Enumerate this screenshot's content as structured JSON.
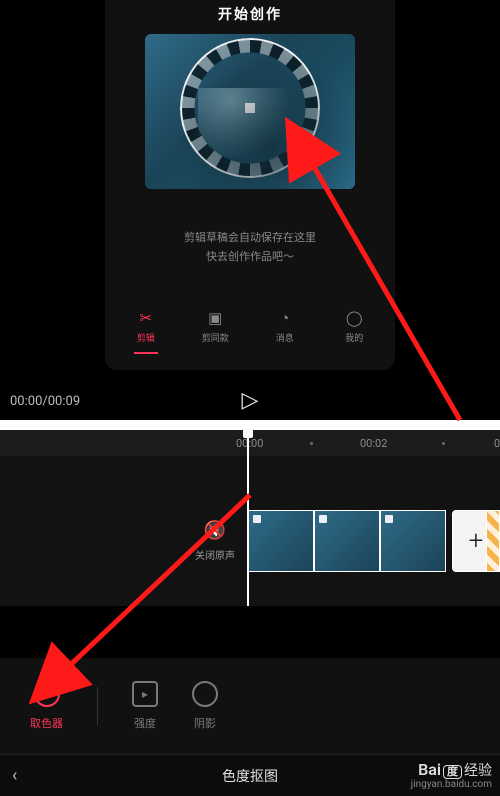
{
  "preview": {
    "title": "开始创作",
    "hint_line1": "剪辑草稿会自动保存在这里",
    "hint_line2": "快去创作作品吧～"
  },
  "nav": {
    "items": [
      {
        "label": "剪辑",
        "icon": "scissors-icon",
        "active": true
      },
      {
        "label": "剪同款",
        "icon": "template-icon",
        "active": false
      },
      {
        "label": "消息",
        "icon": "bell-icon",
        "active": false
      },
      {
        "label": "我的",
        "icon": "user-icon",
        "active": false
      }
    ]
  },
  "transport": {
    "current": "00:00",
    "total": "00:09",
    "play_icon": "▷"
  },
  "ruler": {
    "t1": "00:00",
    "t2": "00:02"
  },
  "mute": {
    "label": "关闭原声",
    "icon": "🔇"
  },
  "add_clip": {
    "label": "+"
  },
  "tools": {
    "picker": {
      "label": "取色器"
    },
    "intensity": {
      "label": "强度",
      "glyph": "▸"
    },
    "shadow": {
      "label": "阴影"
    }
  },
  "bottom": {
    "title": "色度抠图",
    "back": "‹"
  },
  "watermark": {
    "main": "Bai",
    "du_glyph": "度",
    "suffix": "经验",
    "sub": "jingyan.baidu.com"
  }
}
